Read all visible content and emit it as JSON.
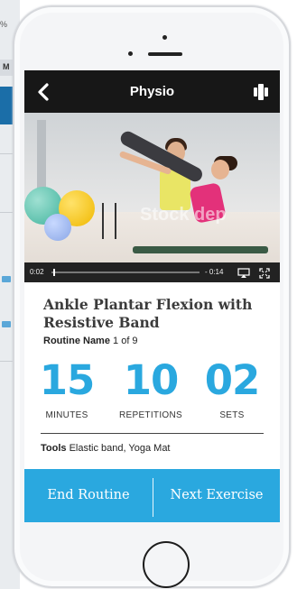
{
  "background_app": {
    "fragment_text": "%",
    "header_fragment": "M"
  },
  "app": {
    "title": "Physio",
    "back_icon": "chevron-left-icon",
    "fitness_icon": "dumbbell-icon"
  },
  "video": {
    "watermark": "Stock dep",
    "time_elapsed": "0:02",
    "time_remaining": "- 0:14",
    "progress_fraction": 0.01
  },
  "exercise": {
    "title": "Ankle Plantar Flexion with Resistive Band",
    "routine_label": "Routine Name",
    "routine_progress": "1 of 9"
  },
  "stats": [
    {
      "value": "15",
      "label": "MINUTES"
    },
    {
      "value": "10",
      "label": "REPETITIONS"
    },
    {
      "value": "02",
      "label": "SETS"
    }
  ],
  "tools": {
    "label": "Tools",
    "value": "Elastic band, Yoga Mat"
  },
  "actions": {
    "end_label": "End Routine",
    "next_label": "Next Exercise"
  },
  "colors": {
    "accent": "#2aa8df",
    "topbar": "#171717"
  }
}
